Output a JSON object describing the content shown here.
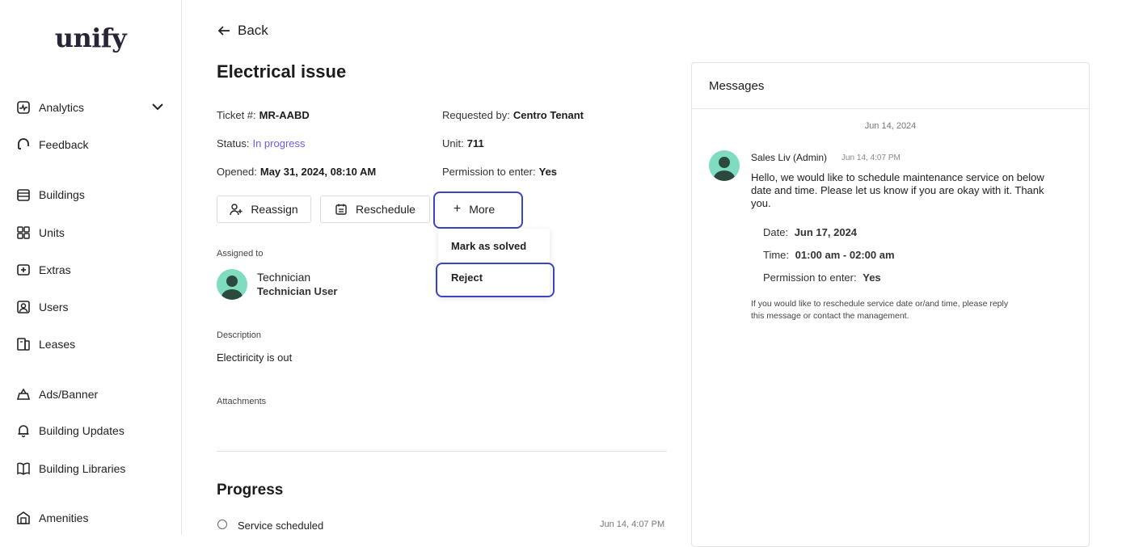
{
  "sidebar": {
    "logo": "unify",
    "items": [
      {
        "label": "Analytics",
        "icon": "analytics-icon"
      },
      {
        "label": "Feedback",
        "icon": "feedback-icon"
      },
      {
        "label": "Buildings",
        "icon": "buildings-icon"
      },
      {
        "label": "Units",
        "icon": "units-icon"
      },
      {
        "label": "Extras",
        "icon": "extras-icon"
      },
      {
        "label": "Users",
        "icon": "users-icon"
      },
      {
        "label": "Leases",
        "icon": "leases-icon"
      },
      {
        "label": "Ads/Banner",
        "icon": "ads-banner-icon"
      },
      {
        "label": "Building Updates",
        "icon": "bell-icon"
      },
      {
        "label": "Building Libraries",
        "icon": "book-icon"
      },
      {
        "label": "Amenities",
        "icon": "amenities-icon"
      }
    ]
  },
  "header": {
    "back_label": "Back"
  },
  "ticket": {
    "title": "Electrical issue",
    "number_label": "Ticket #:",
    "number": "MR-AABD",
    "status_label": "Status:",
    "status": "In progress",
    "opened_label": "Opened:",
    "opened": "May 31, 2024, 08:10 AM",
    "requested_label": "Requested by:",
    "requested_by": "Centro Tenant",
    "unit_label": "Unit:",
    "unit": "711",
    "permission_label": "Permission to enter:",
    "permission": "Yes"
  },
  "actions": {
    "reassign": "Reassign",
    "reschedule": "Reschedule",
    "more": "More",
    "more_menu": [
      "Mark as solved",
      "Reject"
    ]
  },
  "assigned": {
    "label": "Assigned to",
    "role": "Technician",
    "name": "Technician User"
  },
  "description": {
    "label": "Description",
    "text": "Electiricity is out"
  },
  "attachments": {
    "label": "Attachments"
  },
  "progress": {
    "title": "Progress",
    "items": [
      {
        "label": "Service scheduled",
        "time": "Jun 14, 4:07 PM"
      }
    ]
  },
  "messages": {
    "title": "Messages",
    "date_divider": "Jun 14, 2024",
    "items": [
      {
        "author": "Sales Liv (Admin)",
        "time": "Jun 14, 4:07 PM",
        "body_line1": "Hello, we would like to schedule maintenance service on below",
        "body_line2": "date and time. Please let us know if you are okay with it. Thank",
        "body_line3": "you.",
        "date_label": "Date:",
        "date": "Jun 17, 2024",
        "time_label": "Time:",
        "time_range": "01:00 am - 02:00 am",
        "permission_label": "Permission to enter:",
        "permission": "Yes",
        "note_line1": "If you would like to reschedule service date or/and time, please reply",
        "note_line2": "this message or contact the management."
      }
    ]
  },
  "colors": {
    "accent": "#6d5cf0",
    "highlight": "#3b45c4",
    "avatar": "#7fdcc0"
  }
}
